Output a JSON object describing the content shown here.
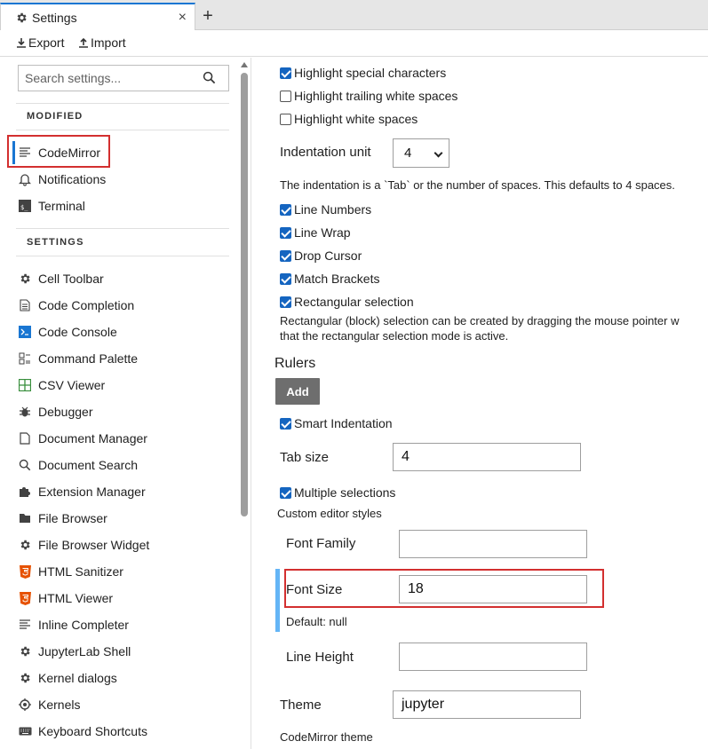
{
  "tab": {
    "title": "Settings",
    "close": "×",
    "new_tab": "+"
  },
  "toolbar": {
    "export_label": "Export",
    "import_label": "Import"
  },
  "search": {
    "placeholder": "Search settings..."
  },
  "sidebar": {
    "modified_heading": "MODIFIED",
    "modified_items": [
      {
        "label": "CodeMirror",
        "icon": "lines-icon"
      },
      {
        "label": "Notifications",
        "icon": "bell-icon"
      },
      {
        "label": "Terminal",
        "icon": "terminal-icon"
      }
    ],
    "settings_heading": "SETTINGS",
    "items": [
      {
        "label": "Cell Toolbar",
        "icon": "gear-icon"
      },
      {
        "label": "Code Completion",
        "icon": "file-lines-icon"
      },
      {
        "label": "Code Console",
        "icon": "console-icon"
      },
      {
        "label": "Command Palette",
        "icon": "palette-icon"
      },
      {
        "label": "CSV Viewer",
        "icon": "grid-icon"
      },
      {
        "label": "Debugger",
        "icon": "bug-icon"
      },
      {
        "label": "Document Manager",
        "icon": "document-icon"
      },
      {
        "label": "Document Search",
        "icon": "search-icon"
      },
      {
        "label": "Extension Manager",
        "icon": "puzzle-icon"
      },
      {
        "label": "File Browser",
        "icon": "folder-icon"
      },
      {
        "label": "File Browser Widget",
        "icon": "gear-icon"
      },
      {
        "label": "HTML Sanitizer",
        "icon": "html5-icon"
      },
      {
        "label": "HTML Viewer",
        "icon": "html5-icon"
      },
      {
        "label": "Inline Completer",
        "icon": "lines-icon"
      },
      {
        "label": "JupyterLab Shell",
        "icon": "gear-icon"
      },
      {
        "label": "Kernel dialogs",
        "icon": "gear-icon"
      },
      {
        "label": "Kernels",
        "icon": "kernel-icon"
      },
      {
        "label": "Keyboard Shortcuts",
        "icon": "keyboard-icon"
      }
    ]
  },
  "editor": {
    "highlight_special": {
      "label": "Highlight special characters",
      "checked": true
    },
    "highlight_trailing": {
      "label": "Highlight trailing white spaces",
      "checked": false
    },
    "highlight_white": {
      "label": "Highlight white spaces",
      "checked": false
    },
    "indentation_unit": {
      "label": "Indentation unit",
      "value": "4"
    },
    "indentation_desc": "The indentation is a `Tab` or the number of spaces. This defaults to 4 spaces.",
    "line_numbers": {
      "label": "Line Numbers",
      "checked": true
    },
    "line_wrap": {
      "label": "Line Wrap",
      "checked": true
    },
    "drop_cursor": {
      "label": "Drop Cursor",
      "checked": true
    },
    "match_brackets": {
      "label": "Match Brackets",
      "checked": true
    },
    "rect_selection": {
      "label": "Rectangular selection",
      "checked": true
    },
    "rect_desc_1": "Rectangular (block) selection can be created by dragging the mouse pointer w",
    "rect_desc_2": "that the rectangular selection mode is active.",
    "rulers_heading": "Rulers",
    "add_button": "Add",
    "smart_indent": {
      "label": "Smart Indentation",
      "checked": true
    },
    "tab_size": {
      "label": "Tab size",
      "value": "4"
    },
    "multiple_selections": {
      "label": "Multiple selections",
      "checked": true
    },
    "custom_styles_heading": "Custom editor styles",
    "font_family": {
      "label": "Font Family",
      "value": ""
    },
    "font_size": {
      "label": "Font Size",
      "value": "18",
      "default_text": "Default: null"
    },
    "line_height": {
      "label": "Line Height",
      "value": ""
    },
    "theme": {
      "label": "Theme",
      "value": "jupyter"
    },
    "theme_desc": "CodeMirror theme"
  },
  "colors": {
    "accent": "#1976d2",
    "checkbox": "#1565c0",
    "highlight_box": "#d32f2f",
    "focus_bar": "#64b5f6",
    "add_button": "#6e6e6e"
  }
}
